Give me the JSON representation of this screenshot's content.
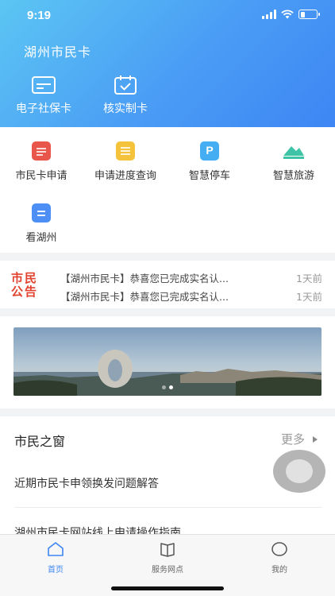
{
  "status_bar": {
    "time": "9:19",
    "battery_level": 0.3
  },
  "header": {
    "title": "湖州市民卡",
    "actions": [
      {
        "label": "电子社保卡",
        "icon": "card-icon"
      },
      {
        "label": "核实制卡",
        "icon": "calendar-check-icon"
      }
    ]
  },
  "services": [
    {
      "label": "市民卡申请",
      "icon": "card-apply-icon",
      "color": "#e9564b"
    },
    {
      "label": "申请进度查询",
      "icon": "progress-query-icon",
      "color": "#f5c33b"
    },
    {
      "label": "智慧停车",
      "icon": "parking-icon",
      "color": "#45aef2"
    },
    {
      "label": "智慧旅游",
      "icon": "mountain-icon",
      "color": "#3fc3a6"
    },
    {
      "label": "看湖州",
      "icon": "view-huzhou-icon",
      "color": "#4d8ff5"
    }
  ],
  "announcement": {
    "logo_text": [
      "市民",
      "公告"
    ],
    "items": [
      {
        "text": "【湖州市民卡】恭喜您已完成实名认...",
        "time": "1天前"
      },
      {
        "text": "【湖州市民卡】恭喜您已完成实名认...",
        "time": "1天前"
      }
    ]
  },
  "banner": {
    "dots": 2,
    "active_index": 1
  },
  "window": {
    "title": "市民之窗",
    "more_label": "更多",
    "items": [
      {
        "title": "近期市民卡申领换发问题解答"
      },
      {
        "title": "湖州市民卡网站线上申请操作指南"
      }
    ]
  },
  "tabbar": {
    "tabs": [
      {
        "label": "首页",
        "icon": "home-icon",
        "active": true
      },
      {
        "label": "服务网点",
        "icon": "book-icon",
        "active": false
      },
      {
        "label": "我的",
        "icon": "profile-circle-icon",
        "active": false
      }
    ]
  },
  "colors": {
    "accent": "#3d86f4",
    "header_start": "#5cc6f3",
    "header_end": "#3d86f4",
    "announce_red": "#e2432f"
  }
}
